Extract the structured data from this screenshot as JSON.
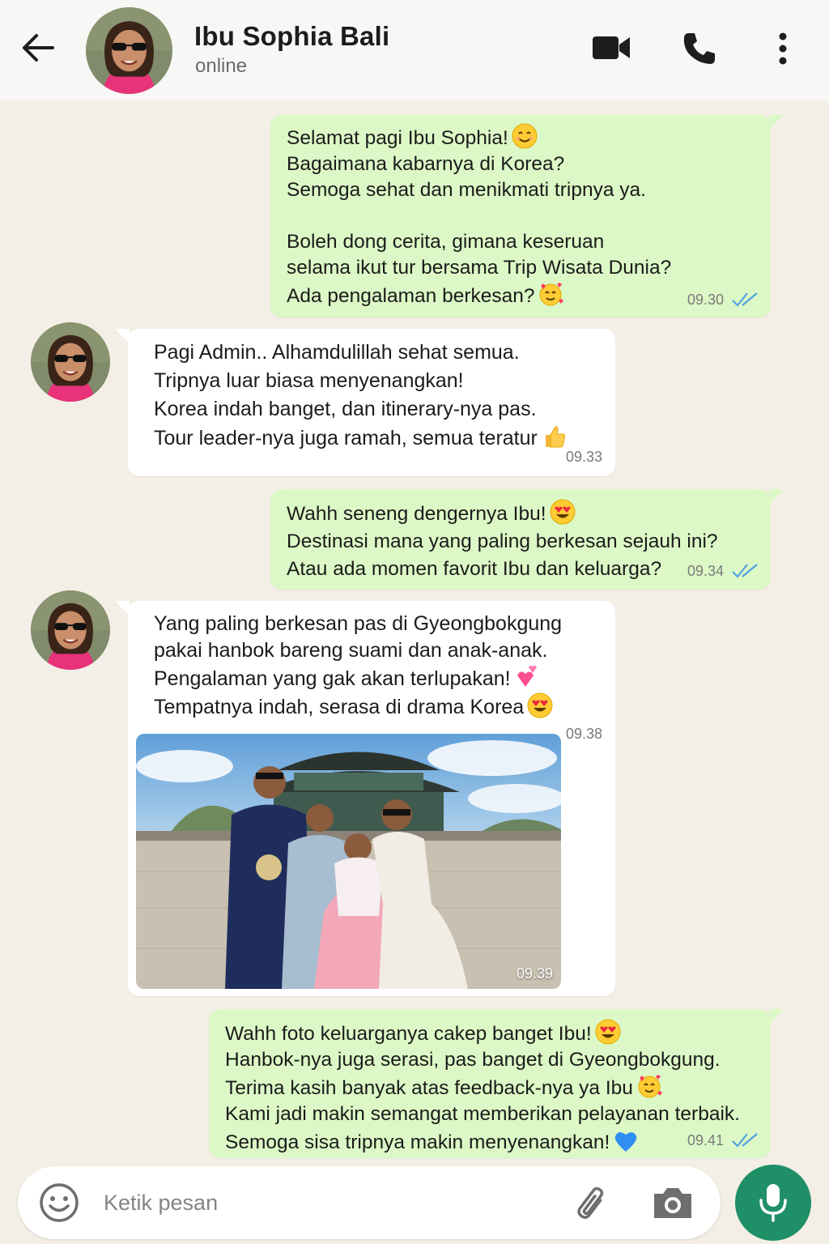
{
  "header": {
    "contact_name": "Ibu Sophia Bali",
    "status": "online",
    "icons": [
      "back-arrow-icon",
      "video-camera-icon",
      "phone-icon",
      "more-vertical-icon"
    ]
  },
  "colors": {
    "outgoing_bubble": "#dcf8c6",
    "incoming_bubble": "#ffffff",
    "chat_background": "#f4efe6",
    "read_ticks": "#4fa3e0",
    "mic_button": "#1e8f66"
  },
  "messages": [
    {
      "direction": "out",
      "lines": [
        "Selamat pagi Ibu Sophia!",
        "Bagaimana kabarnya di Korea?",
        "Semoga sehat dan menikmati tripnya ya.",
        "",
        "Boleh dong cerita, gimana keseruan",
        "selama ikut tur bersama Trip Wisata Dunia?",
        "Ada pengalaman berkesan?"
      ],
      "emojis": [
        "smiling-face",
        "smiling-face-with-hearts"
      ],
      "time": "09.30",
      "status": "read"
    },
    {
      "direction": "in",
      "lines": [
        "Pagi Admin.. Alhamdulillah sehat semua.",
        "Tripnya luar biasa menyenangkan!",
        "Korea indah banget, dan itinerary-nya pas.",
        "Tour leader-nya juga ramah, semua teratur"
      ],
      "emojis": [
        "thumbs-up"
      ],
      "time": "09.33"
    },
    {
      "direction": "out",
      "lines": [
        "Wahh seneng dengernya Ibu!",
        "Destinasi mana yang paling berkesan sejauh ini?",
        "Atau ada momen favorit Ibu dan keluarga?"
      ],
      "emojis": [
        "heart-eyes"
      ],
      "time": "09.34",
      "status": "read"
    },
    {
      "direction": "in",
      "lines": [
        "Yang paling berkesan pas di Gyeongbokgung",
        "pakai hanbok bareng suami dan anak-anak.",
        "Pengalaman yang gak akan terlupakan!",
        "Tempatnya indah, serasa di drama Korea"
      ],
      "emojis": [
        "two-hearts",
        "heart-eyes"
      ],
      "time": "09.38",
      "photo_time": "09.39"
    },
    {
      "direction": "out",
      "lines": [
        "Wahh foto keluarganya cakep banget Ibu!",
        "Hanbok-nya juga serasi, pas banget di Gyeongbokgung.",
        "Terima kasih banyak atas feedback-nya ya Ibu",
        "Kami jadi makin semangat memberikan pelayanan terbaik.",
        "Semoga sisa tripnya makin menyenangkan!"
      ],
      "emojis": [
        "heart-eyes",
        "smiling-face-with-hearts",
        "blue-heart"
      ],
      "time": "09.41",
      "status": "read"
    }
  ],
  "composer": {
    "placeholder": "Ketik pesan",
    "icons": [
      "emoji-icon",
      "paperclip-icon",
      "camera-icon",
      "microphone-icon"
    ]
  }
}
